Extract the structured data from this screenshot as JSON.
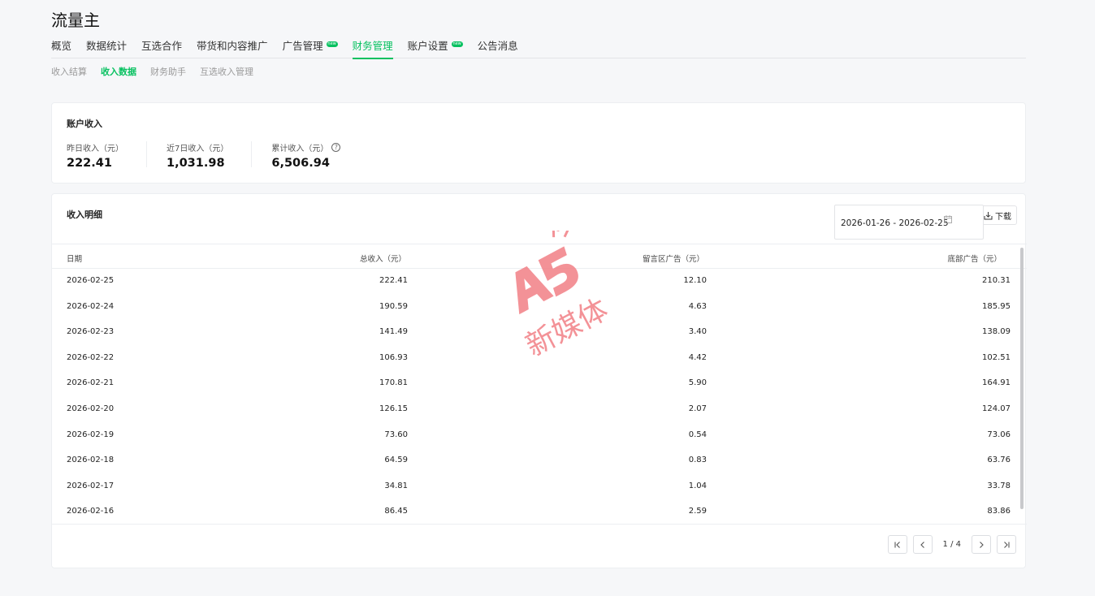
{
  "app": {
    "title": "流量主"
  },
  "nav": {
    "tabs": [
      {
        "label": "概览",
        "active": false,
        "new": false
      },
      {
        "label": "数据统计",
        "active": false,
        "new": false
      },
      {
        "label": "互选合作",
        "active": false,
        "new": false
      },
      {
        "label": "带货和内容推广",
        "active": false,
        "new": false
      },
      {
        "label": "广告管理",
        "active": false,
        "new": true
      },
      {
        "label": "财务管理",
        "active": true,
        "new": false
      },
      {
        "label": "账户设置",
        "active": false,
        "new": true
      },
      {
        "label": "公告消息",
        "active": false,
        "new": false
      }
    ],
    "new_badge": "new",
    "subtabs": [
      {
        "label": "收入结算",
        "active": false
      },
      {
        "label": "收入数据",
        "active": true
      },
      {
        "label": "财务助手",
        "active": false
      },
      {
        "label": "互选收入管理",
        "active": false
      }
    ]
  },
  "summary": {
    "title": "账户收入",
    "stats": [
      {
        "label": "昨日收入（元）",
        "value": "222.41",
        "help": false
      },
      {
        "label": "近7日收入（元）",
        "value": "1,031.98",
        "help": false
      },
      {
        "label": "累计收入（元）",
        "value": "6,506.94",
        "help": true
      }
    ],
    "help_glyph": "?"
  },
  "detail": {
    "title": "收入明细",
    "date_range": "2026-01-26 - 2026-02-25",
    "download_label": "下载",
    "columns": {
      "date": "日期",
      "total": "总收入（元）",
      "comment_ad": "留言区广告（元）",
      "bottom_ad": "底部广告（元）"
    },
    "rows": [
      {
        "date": "2026-02-25",
        "total": "222.41",
        "comment_ad": "12.10",
        "bottom_ad": "210.31"
      },
      {
        "date": "2026-02-24",
        "total": "190.59",
        "comment_ad": "4.63",
        "bottom_ad": "185.95"
      },
      {
        "date": "2026-02-23",
        "total": "141.49",
        "comment_ad": "3.40",
        "bottom_ad": "138.09"
      },
      {
        "date": "2026-02-22",
        "total": "106.93",
        "comment_ad": "4.42",
        "bottom_ad": "102.51"
      },
      {
        "date": "2026-02-21",
        "total": "170.81",
        "comment_ad": "5.90",
        "bottom_ad": "164.91"
      },
      {
        "date": "2026-02-20",
        "total": "126.15",
        "comment_ad": "2.07",
        "bottom_ad": "124.07"
      },
      {
        "date": "2026-02-19",
        "total": "73.60",
        "comment_ad": "0.54",
        "bottom_ad": "73.06"
      },
      {
        "date": "2026-02-18",
        "total": "64.59",
        "comment_ad": "0.83",
        "bottom_ad": "63.76"
      },
      {
        "date": "2026-02-17",
        "total": "34.81",
        "comment_ad": "1.04",
        "bottom_ad": "33.78"
      },
      {
        "date": "2026-02-16",
        "total": "86.45",
        "comment_ad": "2.59",
        "bottom_ad": "83.86"
      }
    ],
    "pagination": {
      "text": "1 / 4"
    }
  },
  "watermark": {
    "logo": "A5",
    "text": "新媒体",
    "color": "#f27f86"
  },
  "colors": {
    "accent": "#07c160"
  },
  "icons": [
    "calendar-icon",
    "download-icon",
    "first-page-icon",
    "prev-page-icon",
    "next-page-icon",
    "last-page-icon",
    "help-icon"
  ]
}
